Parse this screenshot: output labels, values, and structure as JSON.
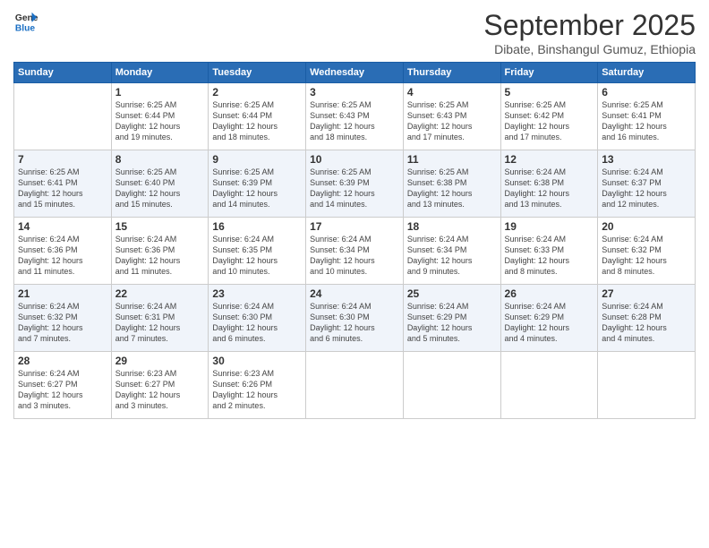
{
  "logo": {
    "line1": "General",
    "line2": "Blue"
  },
  "title": "September 2025",
  "location": "Dibate, Binshangul Gumuz, Ethiopia",
  "headers": [
    "Sunday",
    "Monday",
    "Tuesday",
    "Wednesday",
    "Thursday",
    "Friday",
    "Saturday"
  ],
  "weeks": [
    [
      {
        "day": "",
        "info": ""
      },
      {
        "day": "1",
        "info": "Sunrise: 6:25 AM\nSunset: 6:44 PM\nDaylight: 12 hours\nand 19 minutes."
      },
      {
        "day": "2",
        "info": "Sunrise: 6:25 AM\nSunset: 6:44 PM\nDaylight: 12 hours\nand 18 minutes."
      },
      {
        "day": "3",
        "info": "Sunrise: 6:25 AM\nSunset: 6:43 PM\nDaylight: 12 hours\nand 18 minutes."
      },
      {
        "day": "4",
        "info": "Sunrise: 6:25 AM\nSunset: 6:43 PM\nDaylight: 12 hours\nand 17 minutes."
      },
      {
        "day": "5",
        "info": "Sunrise: 6:25 AM\nSunset: 6:42 PM\nDaylight: 12 hours\nand 17 minutes."
      },
      {
        "day": "6",
        "info": "Sunrise: 6:25 AM\nSunset: 6:41 PM\nDaylight: 12 hours\nand 16 minutes."
      }
    ],
    [
      {
        "day": "7",
        "info": "Sunrise: 6:25 AM\nSunset: 6:41 PM\nDaylight: 12 hours\nand 15 minutes."
      },
      {
        "day": "8",
        "info": "Sunrise: 6:25 AM\nSunset: 6:40 PM\nDaylight: 12 hours\nand 15 minutes."
      },
      {
        "day": "9",
        "info": "Sunrise: 6:25 AM\nSunset: 6:39 PM\nDaylight: 12 hours\nand 14 minutes."
      },
      {
        "day": "10",
        "info": "Sunrise: 6:25 AM\nSunset: 6:39 PM\nDaylight: 12 hours\nand 14 minutes."
      },
      {
        "day": "11",
        "info": "Sunrise: 6:25 AM\nSunset: 6:38 PM\nDaylight: 12 hours\nand 13 minutes."
      },
      {
        "day": "12",
        "info": "Sunrise: 6:24 AM\nSunset: 6:38 PM\nDaylight: 12 hours\nand 13 minutes."
      },
      {
        "day": "13",
        "info": "Sunrise: 6:24 AM\nSunset: 6:37 PM\nDaylight: 12 hours\nand 12 minutes."
      }
    ],
    [
      {
        "day": "14",
        "info": "Sunrise: 6:24 AM\nSunset: 6:36 PM\nDaylight: 12 hours\nand 11 minutes."
      },
      {
        "day": "15",
        "info": "Sunrise: 6:24 AM\nSunset: 6:36 PM\nDaylight: 12 hours\nand 11 minutes."
      },
      {
        "day": "16",
        "info": "Sunrise: 6:24 AM\nSunset: 6:35 PM\nDaylight: 12 hours\nand 10 minutes."
      },
      {
        "day": "17",
        "info": "Sunrise: 6:24 AM\nSunset: 6:34 PM\nDaylight: 12 hours\nand 10 minutes."
      },
      {
        "day": "18",
        "info": "Sunrise: 6:24 AM\nSunset: 6:34 PM\nDaylight: 12 hours\nand 9 minutes."
      },
      {
        "day": "19",
        "info": "Sunrise: 6:24 AM\nSunset: 6:33 PM\nDaylight: 12 hours\nand 8 minutes."
      },
      {
        "day": "20",
        "info": "Sunrise: 6:24 AM\nSunset: 6:32 PM\nDaylight: 12 hours\nand 8 minutes."
      }
    ],
    [
      {
        "day": "21",
        "info": "Sunrise: 6:24 AM\nSunset: 6:32 PM\nDaylight: 12 hours\nand 7 minutes."
      },
      {
        "day": "22",
        "info": "Sunrise: 6:24 AM\nSunset: 6:31 PM\nDaylight: 12 hours\nand 7 minutes."
      },
      {
        "day": "23",
        "info": "Sunrise: 6:24 AM\nSunset: 6:30 PM\nDaylight: 12 hours\nand 6 minutes."
      },
      {
        "day": "24",
        "info": "Sunrise: 6:24 AM\nSunset: 6:30 PM\nDaylight: 12 hours\nand 6 minutes."
      },
      {
        "day": "25",
        "info": "Sunrise: 6:24 AM\nSunset: 6:29 PM\nDaylight: 12 hours\nand 5 minutes."
      },
      {
        "day": "26",
        "info": "Sunrise: 6:24 AM\nSunset: 6:29 PM\nDaylight: 12 hours\nand 4 minutes."
      },
      {
        "day": "27",
        "info": "Sunrise: 6:24 AM\nSunset: 6:28 PM\nDaylight: 12 hours\nand 4 minutes."
      }
    ],
    [
      {
        "day": "28",
        "info": "Sunrise: 6:24 AM\nSunset: 6:27 PM\nDaylight: 12 hours\nand 3 minutes."
      },
      {
        "day": "29",
        "info": "Sunrise: 6:23 AM\nSunset: 6:27 PM\nDaylight: 12 hours\nand 3 minutes."
      },
      {
        "day": "30",
        "info": "Sunrise: 6:23 AM\nSunset: 6:26 PM\nDaylight: 12 hours\nand 2 minutes."
      },
      {
        "day": "",
        "info": ""
      },
      {
        "day": "",
        "info": ""
      },
      {
        "day": "",
        "info": ""
      },
      {
        "day": "",
        "info": ""
      }
    ]
  ]
}
